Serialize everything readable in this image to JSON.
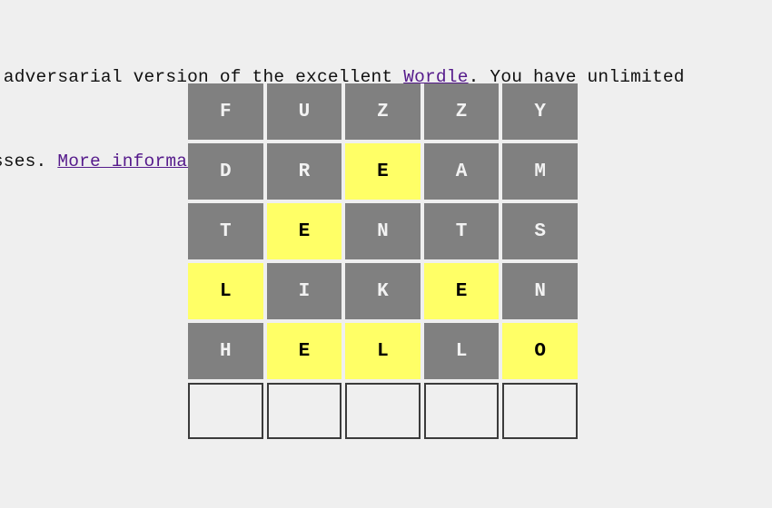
{
  "page": {
    "background_color": "#efefef",
    "link_color": "#551a8b",
    "text_color": "#101010"
  },
  "intro": {
    "line1_prefix": "n adversarial version of the excellent ",
    "line1_link": "Wordle",
    "line1_suffix": ". You have unlimited",
    "line2_prefix": "esses. ",
    "line2_link": "More information",
    "line2_suffix": "."
  },
  "board": {
    "tile_colors": {
      "absent": "#808080",
      "present": "#ffff66",
      "empty_border": "#3b3b3b",
      "absent_text": "#f2f2f2",
      "present_text": "#000000"
    },
    "rows": [
      {
        "word": "FUZZY",
        "tiles": [
          {
            "letter": "F",
            "state": "absent"
          },
          {
            "letter": "U",
            "state": "absent"
          },
          {
            "letter": "Z",
            "state": "absent"
          },
          {
            "letter": "Z",
            "state": "absent"
          },
          {
            "letter": "Y",
            "state": "absent"
          }
        ]
      },
      {
        "word": "DREAM",
        "tiles": [
          {
            "letter": "D",
            "state": "absent"
          },
          {
            "letter": "R",
            "state": "absent"
          },
          {
            "letter": "E",
            "state": "present"
          },
          {
            "letter": "A",
            "state": "absent"
          },
          {
            "letter": "M",
            "state": "absent"
          }
        ]
      },
      {
        "word": "TENTS",
        "tiles": [
          {
            "letter": "T",
            "state": "absent"
          },
          {
            "letter": "E",
            "state": "present"
          },
          {
            "letter": "N",
            "state": "absent"
          },
          {
            "letter": "T",
            "state": "absent"
          },
          {
            "letter": "S",
            "state": "absent"
          }
        ]
      },
      {
        "word": "LIKEN",
        "tiles": [
          {
            "letter": "L",
            "state": "present"
          },
          {
            "letter": "I",
            "state": "absent"
          },
          {
            "letter": "K",
            "state": "absent"
          },
          {
            "letter": "E",
            "state": "present"
          },
          {
            "letter": "N",
            "state": "absent"
          }
        ]
      },
      {
        "word": "HELLO",
        "tiles": [
          {
            "letter": "H",
            "state": "absent"
          },
          {
            "letter": "E",
            "state": "present"
          },
          {
            "letter": "L",
            "state": "present"
          },
          {
            "letter": "L",
            "state": "absent"
          },
          {
            "letter": "O",
            "state": "present"
          }
        ]
      },
      {
        "word": "",
        "tiles": [
          {
            "letter": "",
            "state": "empty"
          },
          {
            "letter": "",
            "state": "empty"
          },
          {
            "letter": "",
            "state": "empty"
          },
          {
            "letter": "",
            "state": "empty"
          },
          {
            "letter": "",
            "state": "empty"
          }
        ]
      }
    ]
  }
}
